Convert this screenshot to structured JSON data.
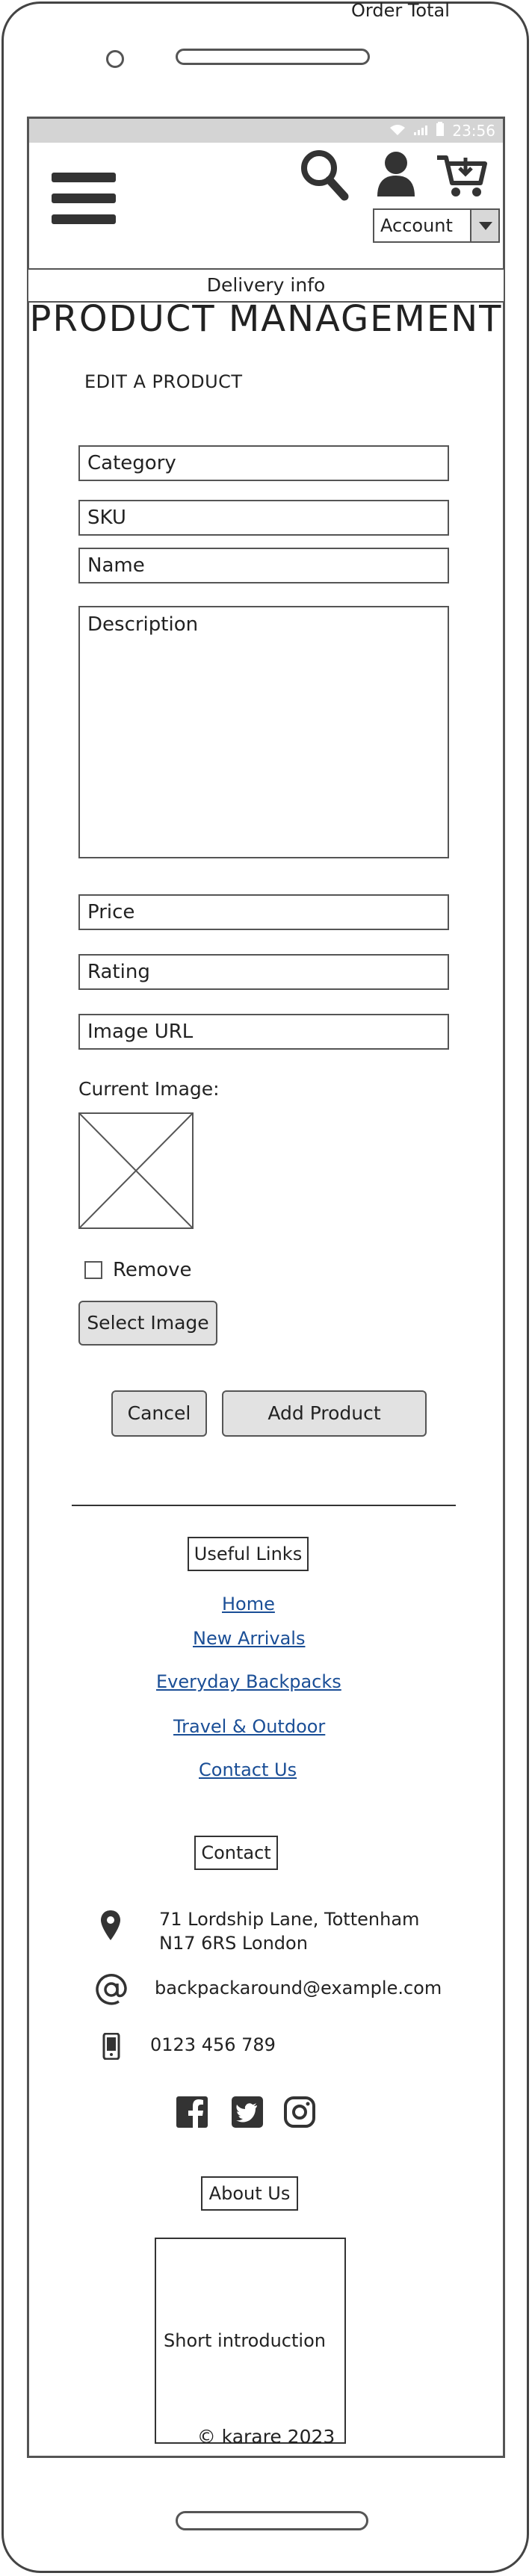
{
  "window": {
    "order_total": "Order Total"
  },
  "statusbar": {
    "time": "23:56"
  },
  "header": {
    "account_label": "Account",
    "delivery": "Delivery info"
  },
  "page": {
    "title": "PRODUCT MANAGEMENT",
    "section": "EDIT A PRODUCT"
  },
  "form": {
    "category": "Category",
    "sku": "SKU",
    "name": "Name",
    "description": "Description",
    "price": "Price",
    "rating": "Rating",
    "image_url": "Image URL",
    "current_image": "Current Image:",
    "remove": "Remove",
    "select_image": "Select Image",
    "cancel": "Cancel",
    "add_product": "Add Product"
  },
  "footer": {
    "useful_links_heading": "Useful Links",
    "links": [
      "Home",
      "New Arrivals",
      "Everyday Backpacks",
      "Travel & Outdoor",
      "Contact Us"
    ],
    "contact_heading": "Contact",
    "address_line1": "71 Lordship Lane, Tottenham",
    "address_line2": "N17 6RS London",
    "email": "backpackaround@example.com",
    "phone": "0123 456 789",
    "about_heading": "About Us",
    "intro": "Short introduction",
    "copyright": "© karare 2023"
  },
  "icons": {
    "menu": "hamburger-icon",
    "search": "search-icon",
    "user": "user-icon",
    "cart": "cart-icon",
    "location": "location-pin-icon",
    "email": "at-icon",
    "phone": "phone-icon",
    "facebook": "facebook-icon",
    "twitter": "twitter-icon",
    "instagram": "instagram-icon"
  },
  "colors": {
    "link": "#1a4e96",
    "statusbar": "#d4d4d4",
    "button": "#e2e2e2"
  }
}
